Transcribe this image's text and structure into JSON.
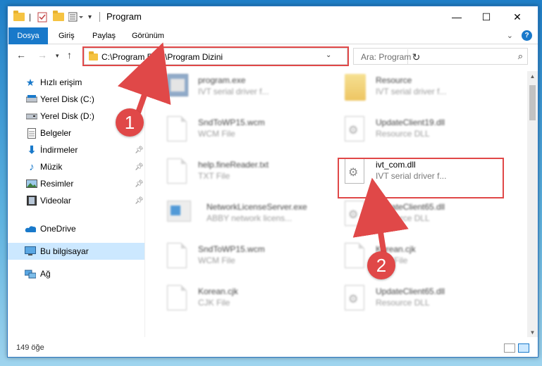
{
  "window": {
    "title": "Program"
  },
  "ribbon": {
    "tabs": [
      "Dosya",
      "Giriş",
      "Paylaş",
      "Görünüm"
    ],
    "help": "?"
  },
  "address": {
    "path": "C:\\Program Files\\Program Dizini",
    "search_placeholder": "Ara: Program"
  },
  "sidebar": {
    "items": [
      {
        "label": "Hızlı erişim",
        "icon": "star-icon"
      },
      {
        "label": "Yerel Disk (C:)",
        "icon": "drive-icon",
        "pinned": false
      },
      {
        "label": "Yerel Disk (D:)",
        "icon": "drive-icon",
        "pinned": false
      },
      {
        "label": "Belgeler",
        "icon": "documents-icon",
        "pinned": false
      },
      {
        "label": "İndirmeler",
        "icon": "download-icon",
        "pinned": true
      },
      {
        "label": "Müzik",
        "icon": "music-icon",
        "pinned": true
      },
      {
        "label": "Resimler",
        "icon": "pictures-icon",
        "pinned": true
      },
      {
        "label": "Videolar",
        "icon": "videos-icon",
        "pinned": true
      },
      {
        "label": "OneDrive",
        "icon": "cloud-icon"
      },
      {
        "label": "Bu bilgisayar",
        "icon": "computer-icon",
        "selected": true
      },
      {
        "label": "Ağ",
        "icon": "network-icon"
      }
    ]
  },
  "files": [
    {
      "name": "program.exe",
      "desc": "IVT serial driver f...",
      "type": "exe",
      "blurred": true
    },
    {
      "name": "Resource",
      "desc": "IVT serial driver f...",
      "type": "folder",
      "blurred": true
    },
    {
      "name": "SndToWP15.wcm",
      "desc": "WCM File",
      "type": "doc",
      "blurred": true
    },
    {
      "name": "UpdateClient19.dll",
      "desc": "Resource DLL",
      "type": "dll",
      "blurred": true
    },
    {
      "name": "help.fineReader.txt",
      "desc": "TXT File",
      "type": "doc",
      "blurred": true
    },
    {
      "name": "ivt_com.dll",
      "desc": "IVT serial driver f...",
      "type": "dll",
      "blurred": false
    },
    {
      "name": "NetworkLicenseServer.exe",
      "desc": "ABBY network licens...",
      "type": "netexe",
      "blurred": true
    },
    {
      "name": "UpdateClient65.dll",
      "desc": "Resource DLL",
      "type": "dll",
      "blurred": true
    },
    {
      "name": "SndToWP15.wcm",
      "desc": "WCM File",
      "type": "doc",
      "blurred": true
    },
    {
      "name": "Korean.cjk",
      "desc": "CJK File",
      "type": "doc",
      "blurred": true
    },
    {
      "name": "Korean.cjk",
      "desc": "CJK File",
      "type": "doc",
      "blurred": true
    },
    {
      "name": "UpdateClient65.dll",
      "desc": "Resource DLL",
      "type": "dll",
      "blurred": true
    }
  ],
  "status": {
    "item_count": "149 öğe"
  },
  "annotations": {
    "step1": "1",
    "step2": "2",
    "color": "#e04848"
  }
}
